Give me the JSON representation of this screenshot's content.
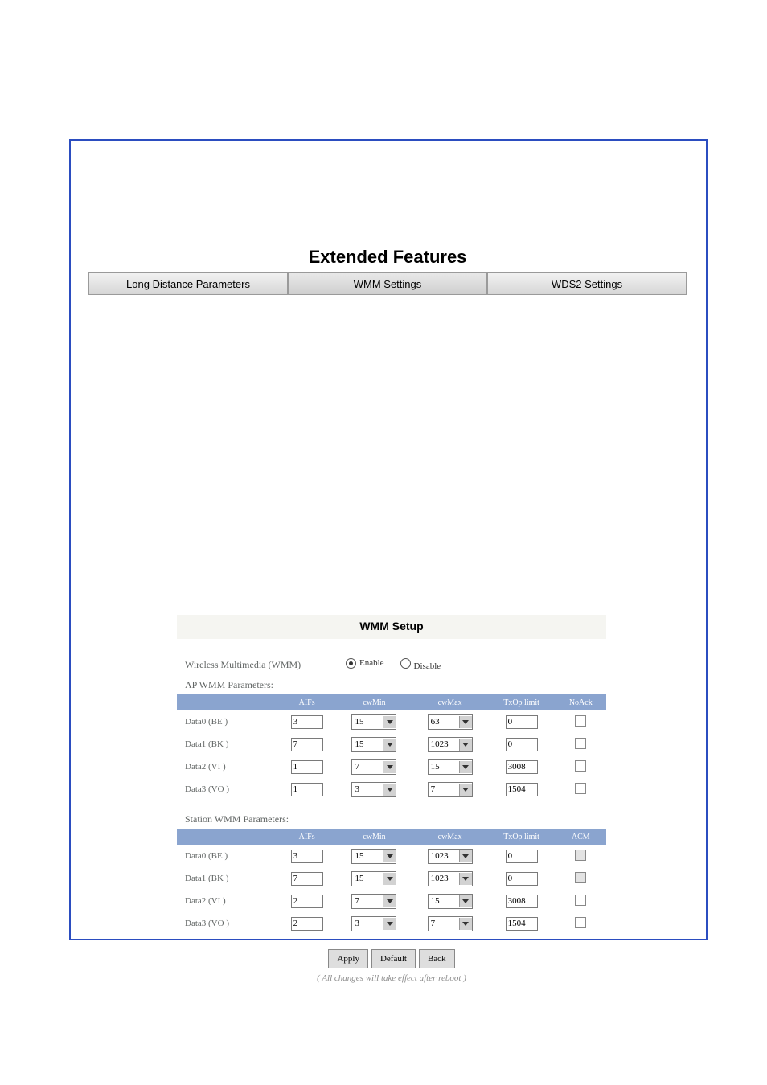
{
  "feature": {
    "title": "Extended Features",
    "tabs": [
      "Long Distance Parameters",
      "WMM Settings",
      "WDS2 Settings"
    ],
    "active_tab": 1
  },
  "panel": {
    "title": "WMM Setup",
    "wmm_label": "Wireless Multimedia (WMM)",
    "enable": "Enable",
    "disable": "Disable",
    "ap_section": "AP WMM Parameters:",
    "sta_section": "Station WMM Parameters:",
    "headers_ap": [
      "",
      "AIFs",
      "cwMin",
      "cwMax",
      "TxOp limit",
      "NoAck"
    ],
    "headers_sta": [
      "",
      "AIFs",
      "cwMin",
      "cwMax",
      "TxOp limit",
      "ACM"
    ],
    "rows_ap": [
      {
        "name": "Data0 (BE )",
        "aifs": "3",
        "cwmin": "15",
        "cwmax": "63",
        "txop": "0"
      },
      {
        "name": "Data1 (BK )",
        "aifs": "7",
        "cwmin": "15",
        "cwmax": "1023",
        "txop": "0"
      },
      {
        "name": "Data2 (VI )",
        "aifs": "1",
        "cwmin": "7",
        "cwmax": "15",
        "txop": "3008"
      },
      {
        "name": "Data3 (VO )",
        "aifs": "1",
        "cwmin": "3",
        "cwmax": "7",
        "txop": "1504"
      }
    ],
    "rows_sta": [
      {
        "name": "Data0 (BE )",
        "aifs": "3",
        "cwmin": "15",
        "cwmax": "1023",
        "txop": "0"
      },
      {
        "name": "Data1 (BK )",
        "aifs": "7",
        "cwmin": "15",
        "cwmax": "1023",
        "txop": "0"
      },
      {
        "name": "Data2 (VI )",
        "aifs": "2",
        "cwmin": "7",
        "cwmax": "15",
        "txop": "3008"
      },
      {
        "name": "Data3 (VO )",
        "aifs": "2",
        "cwmin": "3",
        "cwmax": "7",
        "txop": "1504"
      }
    ],
    "buttons": {
      "apply": "Apply",
      "default": "Default",
      "back": "Back"
    },
    "note": "( All changes will take effect after reboot )"
  }
}
